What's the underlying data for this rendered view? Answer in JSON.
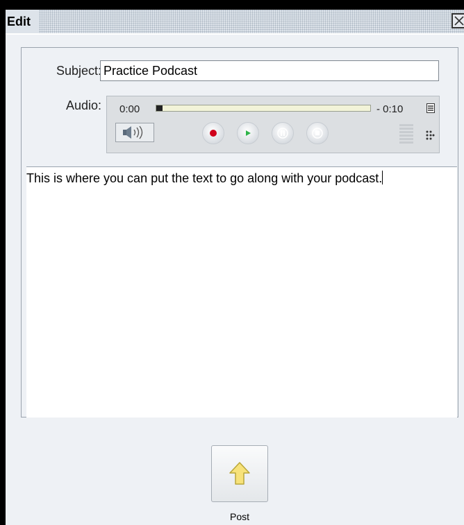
{
  "window": {
    "title": "Edit"
  },
  "form": {
    "subject_label": "Subject:",
    "subject_value": "Practice Podcast",
    "audio_label": "Audio:"
  },
  "audio_player": {
    "time_elapsed": "0:00",
    "time_remaining": "- 0:10",
    "progress_fraction": 0.0,
    "controls": [
      "volume-button",
      "record-button",
      "play-button",
      "pause-button",
      "stop-button"
    ],
    "record_color": "#d0021b",
    "play_color": "#2fb44a"
  },
  "editor": {
    "text": "This is where you can put the text to go along with your podcast."
  },
  "actions": {
    "post_label": "Post",
    "post_icon": "up-arrow-icon",
    "post_icon_color": "#f7e27a"
  }
}
